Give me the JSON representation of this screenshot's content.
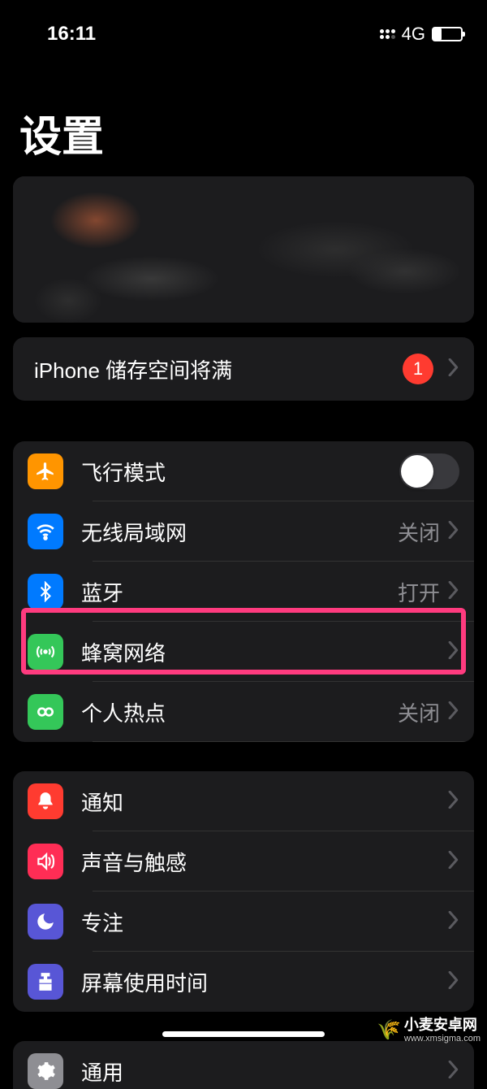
{
  "status_bar": {
    "time": "16:11",
    "network": "4G"
  },
  "page_title": "设置",
  "storage_notice": {
    "label": "iPhone 储存空间将满",
    "badge": "1"
  },
  "connectivity": {
    "airplane": {
      "label": "飞行模式"
    },
    "wifi": {
      "label": "无线局域网",
      "value": "关闭"
    },
    "bluetooth": {
      "label": "蓝牙",
      "value": "打开"
    },
    "cellular": {
      "label": "蜂窝网络"
    },
    "hotspot": {
      "label": "个人热点",
      "value": "关闭"
    }
  },
  "general_group": {
    "notifications": {
      "label": "通知"
    },
    "sounds": {
      "label": "声音与触感"
    },
    "focus": {
      "label": "专注"
    },
    "screentime": {
      "label": "屏幕使用时间"
    }
  },
  "bottom_group": {
    "general": {
      "label": "通用"
    }
  },
  "watermark": {
    "name": "小麦安卓网",
    "url": "www.xmsigma.com"
  }
}
